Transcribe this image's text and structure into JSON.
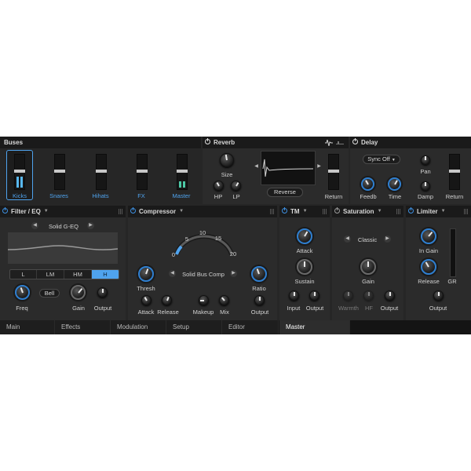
{
  "buses": {
    "title": "Buses",
    "items": [
      {
        "label": "Kicks",
        "selected": true,
        "meter": 0.7
      },
      {
        "label": "Snares",
        "selected": false,
        "meter": 0
      },
      {
        "label": "Hihats",
        "selected": false,
        "meter": 0
      },
      {
        "label": "FX",
        "selected": false,
        "meter": 0
      },
      {
        "label": "Master",
        "selected": false,
        "meter": 0.4
      }
    ]
  },
  "reverb": {
    "title": "Reverb",
    "size": "Size",
    "hp": "HP",
    "lp": "LP",
    "reverse": "Reverse",
    "return": "Return"
  },
  "delay": {
    "title": "Delay",
    "sync": "Sync Off",
    "pan": "Pan",
    "damp": "Damp",
    "feedb": "Feedb",
    "time": "Time",
    "return": "Return"
  },
  "filter": {
    "title": "Filter / EQ",
    "preset": "Solid G-EQ",
    "bands": [
      "L",
      "LM",
      "HM",
      "H"
    ],
    "active_band": "H",
    "bell": "Bell",
    "freq": "Freq",
    "gain": "Gain",
    "output": "Output"
  },
  "compressor": {
    "title": "Compressor",
    "scale": [
      "0",
      "5",
      "10",
      "15",
      "20"
    ],
    "mode": "Solid Bus Comp",
    "thresh": "Thresh",
    "ratio": "Ratio",
    "attack": "Attack",
    "release": "Release",
    "makeup": "Makeup",
    "mix": "Mix",
    "output": "Output"
  },
  "tm": {
    "title": "TM",
    "attack": "Attack",
    "sustain": "Sustain",
    "input": "Input",
    "output": "Output"
  },
  "saturation": {
    "title": "Saturation",
    "mode": "Classic",
    "gain": "Gain",
    "warmth": "Warmth",
    "hf": "HF",
    "output": "Output"
  },
  "limiter": {
    "title": "Limiter",
    "in_gain": "In Gain",
    "release": "Release",
    "gr": "GR",
    "output": "Output"
  },
  "tabs": [
    "Main",
    "Effects",
    "Modulation",
    "Setup",
    "Editor"
  ],
  "master_tab": "Master",
  "colors": {
    "accent": "#4fa3ee",
    "background": "#262626",
    "header": "#1a1a1a"
  }
}
